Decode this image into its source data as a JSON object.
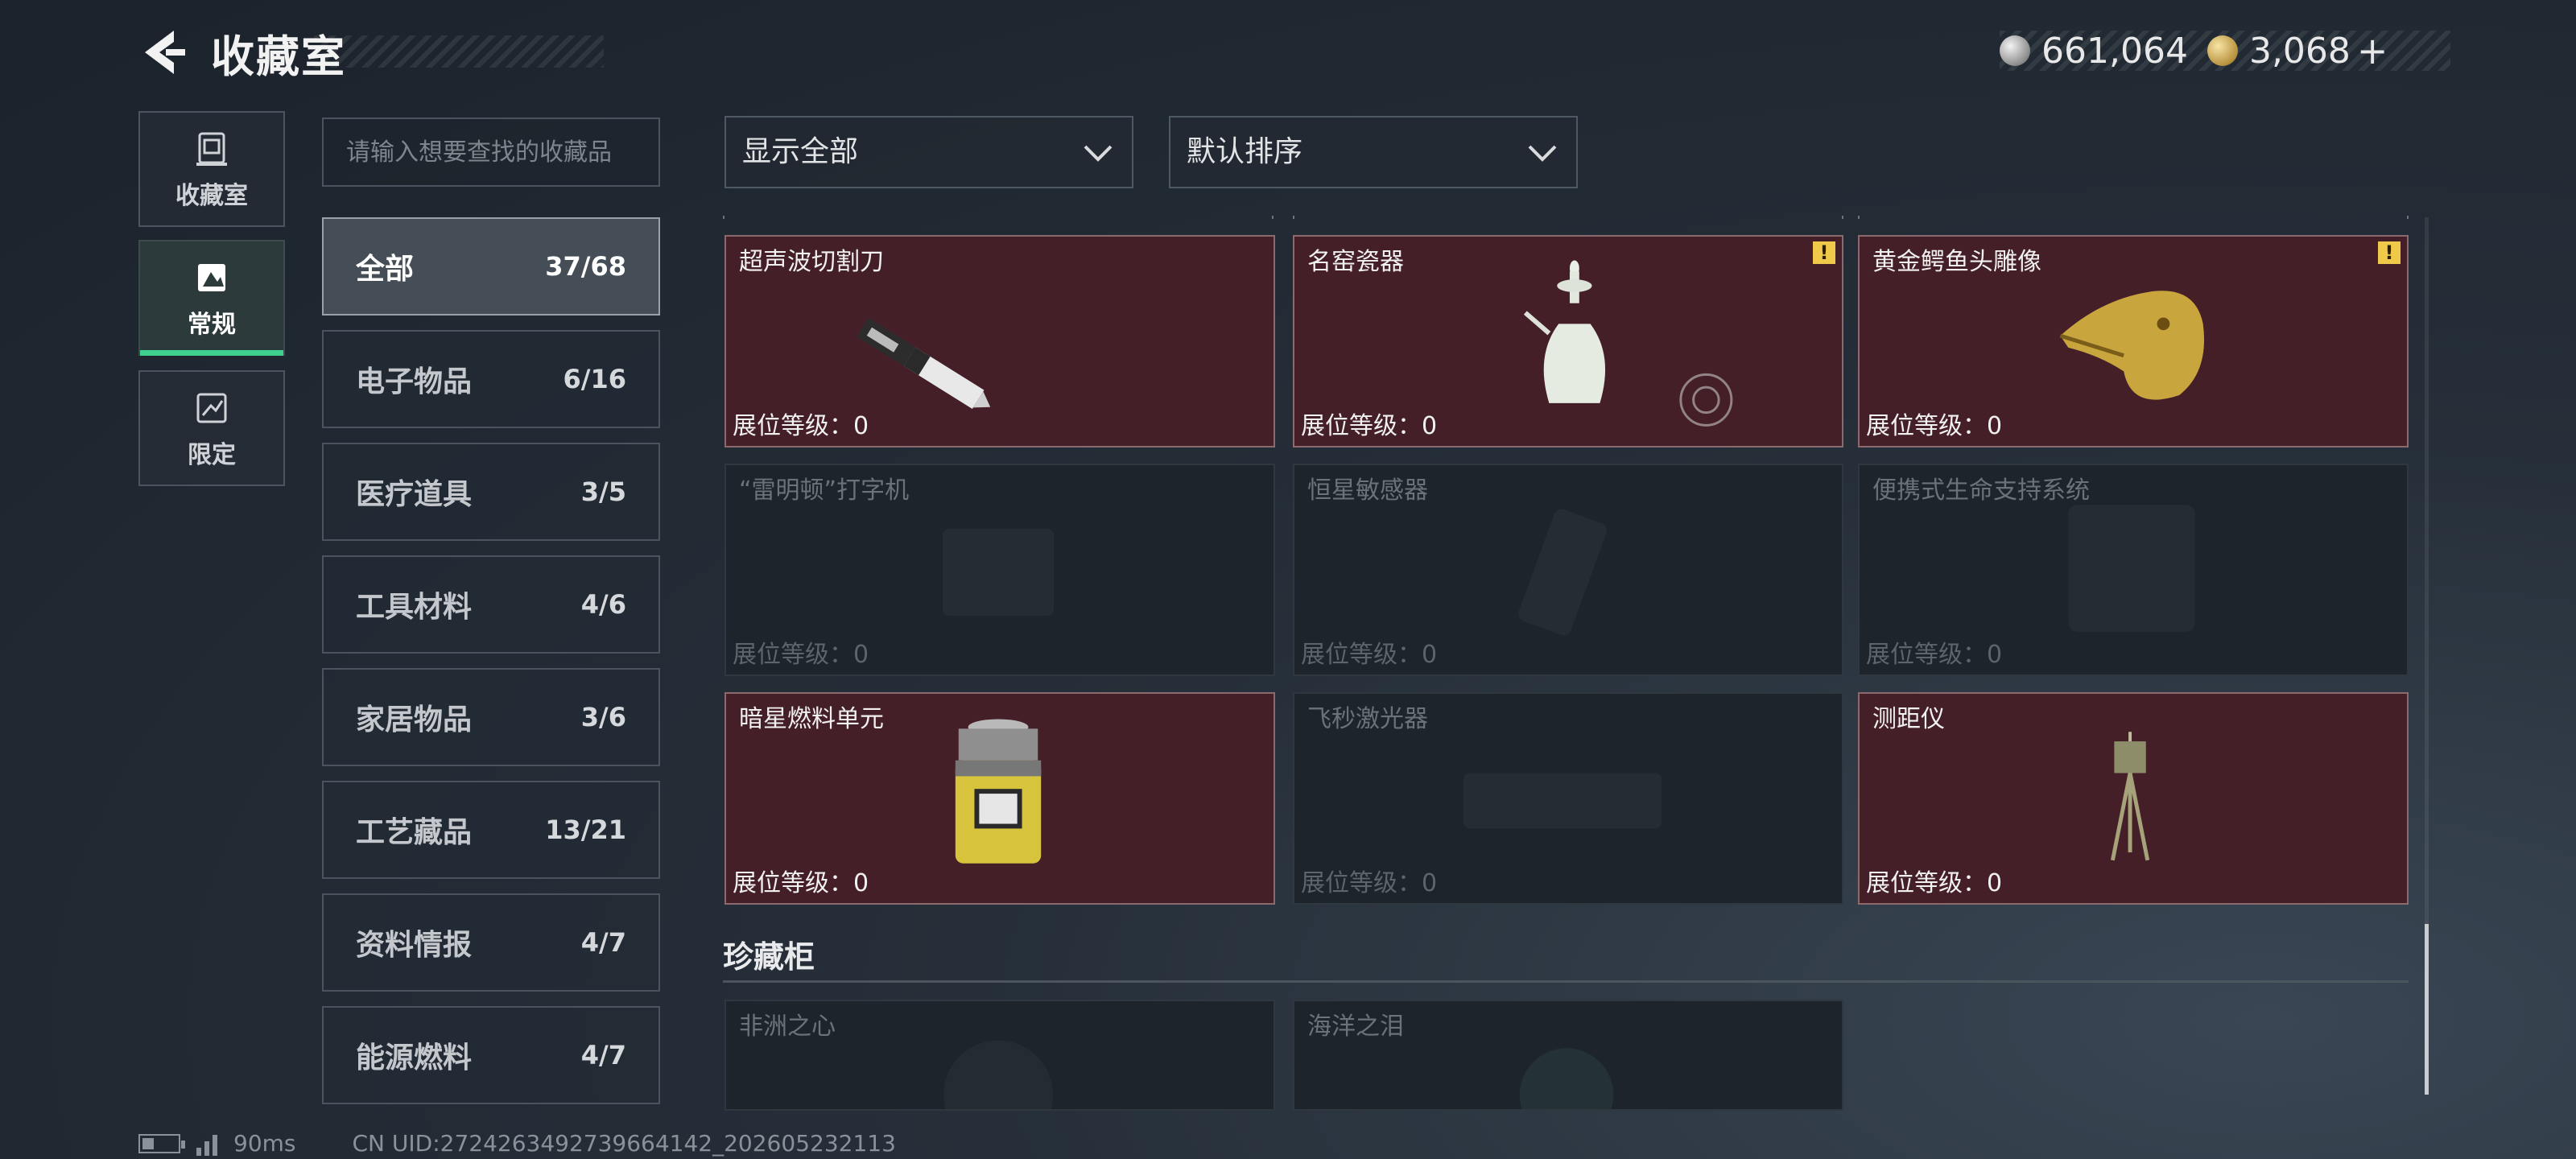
{
  "header": {
    "title": "收藏室",
    "currency_silver": "661,064",
    "currency_gold": "3,068",
    "gold_plus": "+"
  },
  "left_tabs": [
    {
      "label": "收藏室",
      "icon": "collection-room-icon"
    },
    {
      "label": "常规",
      "icon": "regular-icon",
      "active": true
    },
    {
      "label": "限定",
      "icon": "limited-icon"
    }
  ],
  "search": {
    "placeholder": "请输入想要查找的收藏品"
  },
  "categories": [
    {
      "name": "全部",
      "count": "37/68",
      "active": true
    },
    {
      "name": "电子物品",
      "count": "6/16"
    },
    {
      "name": "医疗道具",
      "count": "3/5"
    },
    {
      "name": "工具材料",
      "count": "4/6"
    },
    {
      "name": "家居物品",
      "count": "3/6"
    },
    {
      "name": "工艺藏品",
      "count": "13/21"
    },
    {
      "name": "资料情报",
      "count": "4/7"
    },
    {
      "name": "能源燃料",
      "count": "4/7"
    }
  ],
  "filters": {
    "display": "显示全部",
    "sort": "默认排序"
  },
  "items": [
    {
      "name": "超声波切割刀",
      "level": "展位等级：0",
      "owned": true,
      "warning": false,
      "icon": "ultrasonic-knife-icon"
    },
    {
      "name": "名窑瓷器",
      "level": "展位等级：0",
      "owned": true,
      "warning": true,
      "icon": "porcelain-vase-icon"
    },
    {
      "name": "黄金鳄鱼头雕像",
      "level": "展位等级：0",
      "owned": true,
      "warning": true,
      "icon": "golden-crocodile-head-icon"
    },
    {
      "name": "“雷明顿”打字机",
      "level": "展位等级：0",
      "owned": false,
      "icon": "typewriter-icon"
    },
    {
      "name": "恒星敏感器",
      "level": "展位等级：0",
      "owned": false,
      "icon": "star-sensor-icon"
    },
    {
      "name": "便携式生命支持系统",
      "level": "展位等级：0",
      "owned": false,
      "icon": "life-support-icon"
    },
    {
      "name": "暗星燃料单元",
      "level": "展位等级：0",
      "owned": true,
      "warning": false,
      "icon": "fuel-cell-icon"
    },
    {
      "name": "飞秒激光器",
      "level": "展位等级：0",
      "owned": false,
      "icon": "laser-icon"
    },
    {
      "name": "测距仪",
      "level": "展位等级：0",
      "owned": true,
      "warning": false,
      "icon": "rangefinder-icon"
    }
  ],
  "treasure_section": {
    "title": "珍藏柜",
    "items": [
      {
        "name": "非洲之心",
        "owned": false
      },
      {
        "name": "海洋之泪",
        "owned": false
      }
    ]
  },
  "footer": {
    "ping": "90ms",
    "uid": "CN UID:27242634927396641​42_202605232113"
  },
  "colors": {
    "accent_green": "#3fcf8e",
    "owned_bg": "#451f27",
    "warning": "#f0c94a"
  }
}
